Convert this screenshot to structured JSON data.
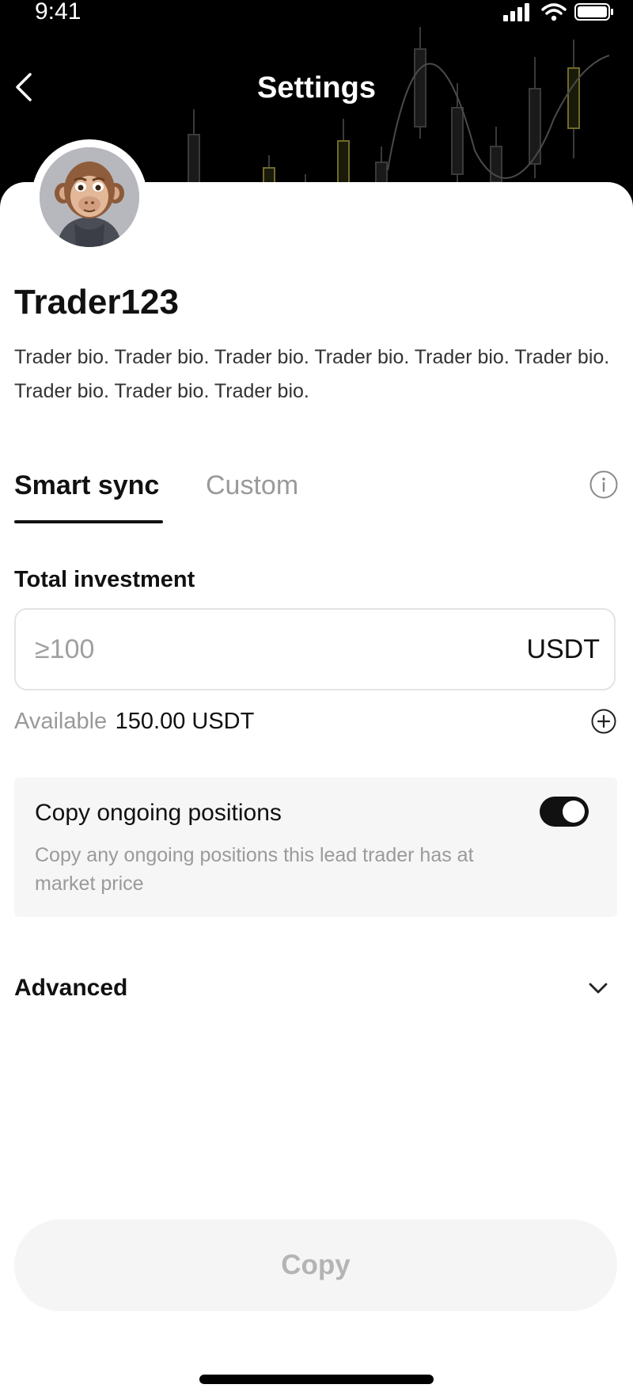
{
  "status_bar": {
    "time": "9:41",
    "icons": [
      "signal-icon",
      "wifi-icon",
      "battery-icon"
    ]
  },
  "header": {
    "title": "Settings",
    "back_icon": "chevron-left-icon"
  },
  "profile": {
    "name": "Trader123",
    "bio": "Trader bio. Trader bio. Trader bio. Trader bio. Trader bio. Trader bio. Trader bio. Trader bio. Trader bio."
  },
  "tabs": [
    {
      "label": "Smart sync",
      "active": true
    },
    {
      "label": "Custom",
      "active": false
    }
  ],
  "investment": {
    "label": "Total investment",
    "placeholder": "≥100",
    "value": "",
    "unit": "USDT",
    "available_label": "Available",
    "available_value": "150.00 USDT"
  },
  "copy_positions": {
    "title": "Copy ongoing positions",
    "description": "Copy any ongoing positions this lead trader has at market price",
    "enabled": true
  },
  "advanced": {
    "label": "Advanced"
  },
  "footer": {
    "copy_label": "Copy"
  },
  "colors": {
    "accent": "#111111",
    "muted_text": "#9a9a9a",
    "card_bg": "#f6f6f6",
    "disabled_button_bg": "#f5f5f5",
    "disabled_button_text": "#b4b4b4"
  }
}
